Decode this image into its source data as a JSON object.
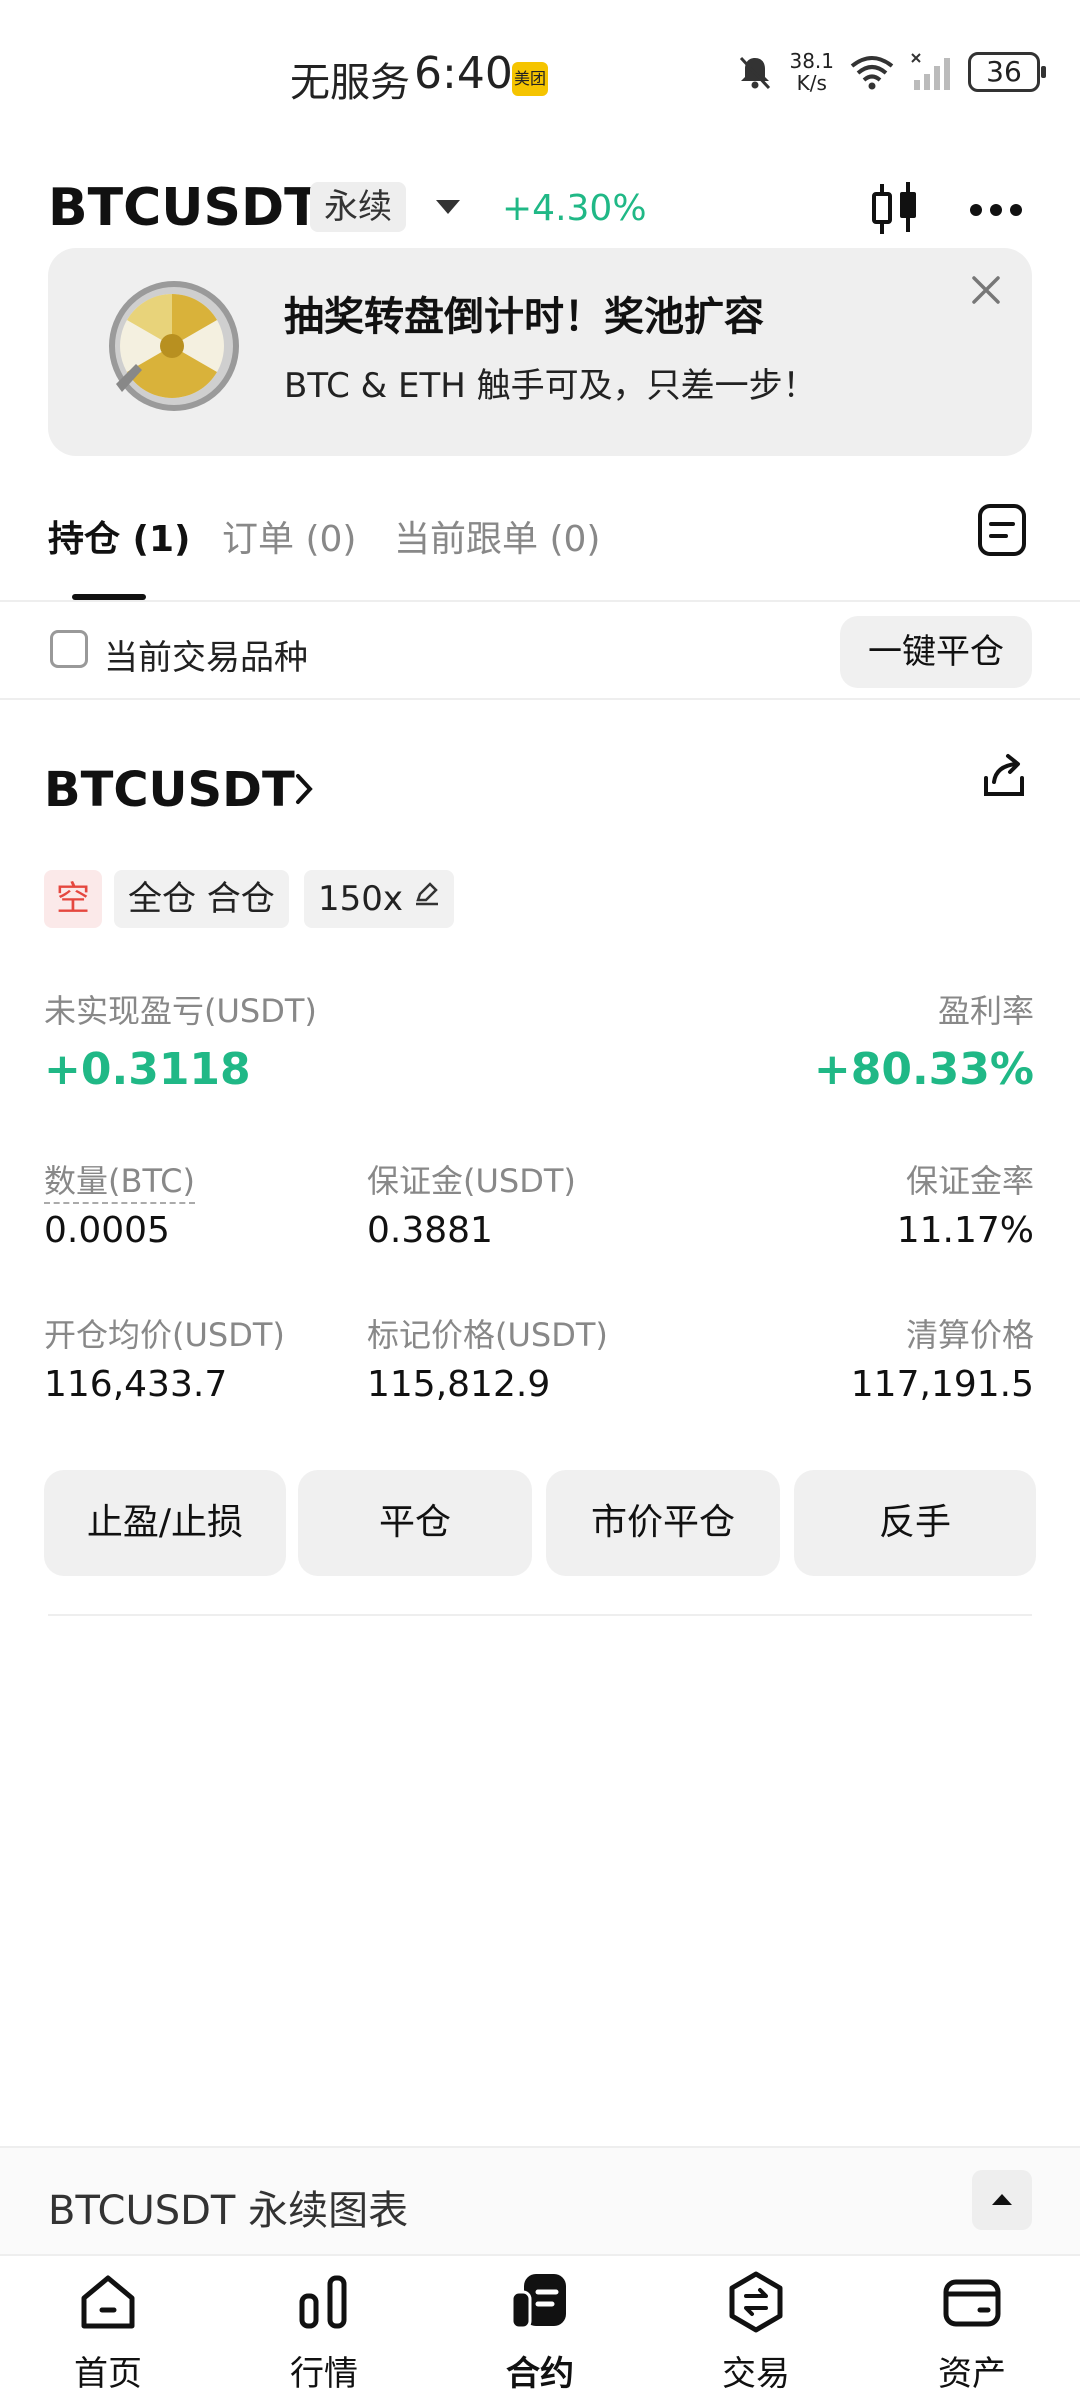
{
  "status_bar": {
    "carrier": "无服务",
    "time": "6:40",
    "app_badge": "美团",
    "net_speed_value": "38.1",
    "net_speed_unit": "K/s",
    "battery": "36"
  },
  "header": {
    "symbol": "BTCUSDT",
    "contract_type": "永续",
    "change": "+4.30%"
  },
  "banner": {
    "title": "抽奖转盘倒计时！奖池扩容",
    "subtitle": "BTC & ETH 触手可及，只差一步！"
  },
  "tabs": [
    {
      "label": "持仓 (1)"
    },
    {
      "label": "订单 (0)"
    },
    {
      "label": "当前跟单 (0)"
    }
  ],
  "filter": {
    "checkbox_label": "当前交易品种",
    "close_all": "一键平仓"
  },
  "position": {
    "symbol": "BTCUSDT",
    "side": "空",
    "margin_mode": "全仓 合仓",
    "leverage": "150x",
    "upnl_label": "未实现盈亏(USDT)",
    "upnl_value": "+0.3118",
    "roe_label": "盈利率",
    "roe_value": "+80.33%",
    "qty_label": "数量(BTC)",
    "qty_value": "0.0005",
    "margin_label": "保证金(USDT)",
    "margin_value": "0.3881",
    "margin_ratio_label": "保证金率",
    "margin_ratio_value": "11.17%",
    "entry_label": "开仓均价(USDT)",
    "entry_value": "116,433.7",
    "mark_label": "标记价格(USDT)",
    "mark_value": "115,812.9",
    "liq_label": "清算价格",
    "liq_value": "117,191.5",
    "actions": [
      "止盈/止损",
      "平仓",
      "市价平仓",
      "反手"
    ]
  },
  "chart_bar": {
    "title": "BTCUSDT 永续图表"
  },
  "bottom_nav": [
    {
      "label": "首页",
      "icon": "home-icon"
    },
    {
      "label": "行情",
      "icon": "market-icon"
    },
    {
      "label": "合约",
      "icon": "futures-icon"
    },
    {
      "label": "交易",
      "icon": "trade-icon"
    },
    {
      "label": "资产",
      "icon": "wallet-icon"
    }
  ],
  "colors": {
    "positive": "#20b886",
    "negative": "#e5473f",
    "badge": "#f5c400"
  }
}
